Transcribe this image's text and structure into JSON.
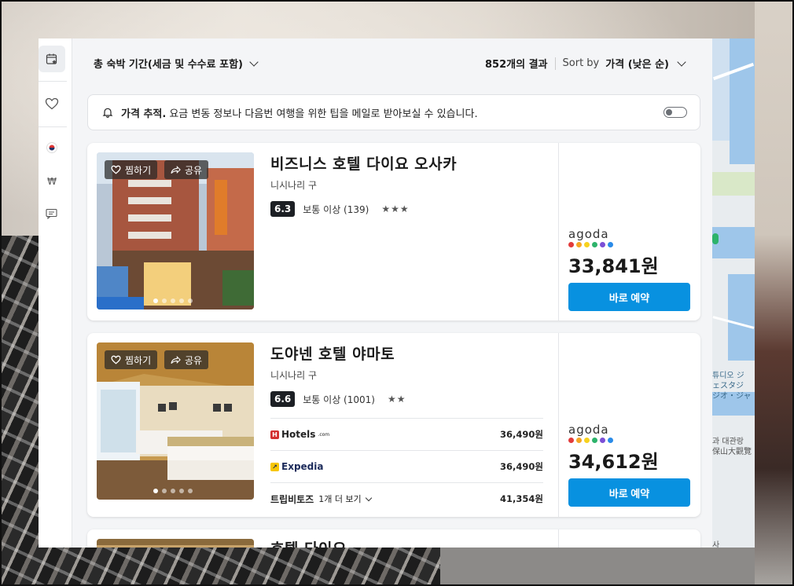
{
  "header": {
    "period_label": "총 숙박 기간(세금 및 수수료 포함)",
    "results_count": "852개의 결과",
    "sort_by_label": "Sort by",
    "sort_value": "가격 (낮은 순)"
  },
  "price_tracking": {
    "title": "가격 추적.",
    "text": "요금 변동 정보나 다음번 여행을 위한 팁을 메일로 받아보실 수 있습니다.",
    "enabled": false
  },
  "photo_actions": {
    "save": "찜하기",
    "share": "공유"
  },
  "hotels": [
    {
      "name": "비즈니스 호텔 다이요 오사카",
      "district": "니시나리 구",
      "score": "6.3",
      "rating_text": "보통 이상 (139)",
      "stars": "★★★",
      "deal_provider": "agoda",
      "deal_price": "33,841원",
      "book_label": "바로 예약",
      "offers": []
    },
    {
      "name": "도야넨 호텔 야마토",
      "district": "니시나리 구",
      "score": "6.6",
      "rating_text": "보통 이상 (1001)",
      "stars": "★★",
      "deal_provider": "agoda",
      "deal_price": "34,612원",
      "book_label": "바로 예약",
      "offers": [
        {
          "provider": "Hotels",
          "suffix": ".com",
          "price": "36,490원"
        },
        {
          "provider": "Expedia",
          "price": "36,490원"
        },
        {
          "provider": "트립비토즈",
          "more": "1개 더 보기",
          "price": "41,354원"
        }
      ]
    },
    {
      "name": "호텔 다이요"
    }
  ],
  "colors": {
    "book_button": "#0891e0",
    "score_badge": "#1c1f24",
    "agoda_dots": [
      "#e23b3b",
      "#f5a623",
      "#f7d21e",
      "#2db36b",
      "#7b4fd6",
      "#2a8be8"
    ]
  },
  "map": {
    "labels": [
      "튜디오 ジ",
      "ェスタジ",
      "ジオ・ジャ",
      "과 대관랑",
      "保山大觀覽",
      "사"
    ]
  },
  "sidebar": {
    "icons": [
      "calendar-star-icon",
      "heart-icon",
      "korea-flag-icon",
      "won-currency-icon",
      "feedback-icon"
    ]
  }
}
